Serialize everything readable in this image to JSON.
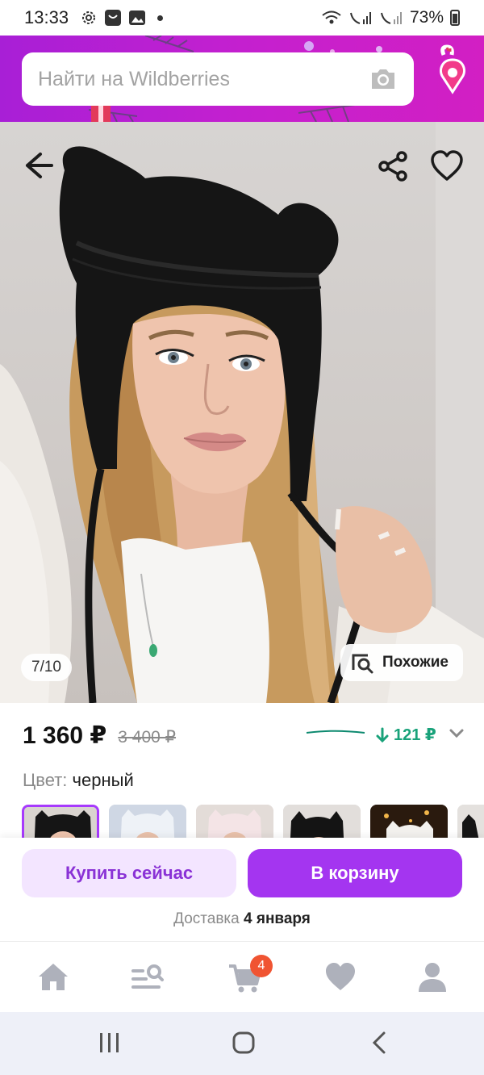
{
  "status_bar": {
    "time": "13:33",
    "battery": "73%"
  },
  "search": {
    "placeholder": "Найти на Wildberries"
  },
  "product": {
    "image_counter": "7/10",
    "similar_label": "Похожие",
    "price": "1 360 ₽",
    "old_price": "3 400 ₽",
    "price_drop": "121 ₽",
    "color_label": "Цвет:",
    "color_value": "черный"
  },
  "actions": {
    "buy_now": "Купить сейчас",
    "add_to_cart": "В корзину",
    "delivery_label": "Доставка",
    "delivery_date": "4 января"
  },
  "bottom_nav": {
    "cart_badge": "4",
    "items": [
      "home-icon",
      "catalog-search-icon",
      "cart-icon",
      "favorites-icon",
      "profile-icon"
    ]
  },
  "colors": {
    "brand_gradient_start": "#a81fd6",
    "brand_gradient_end": "#d21fc3",
    "primary_button": "#a435f0",
    "secondary_button": "#f3e5ff",
    "price_drop_green": "#19a27a",
    "badge": "#f05432"
  }
}
